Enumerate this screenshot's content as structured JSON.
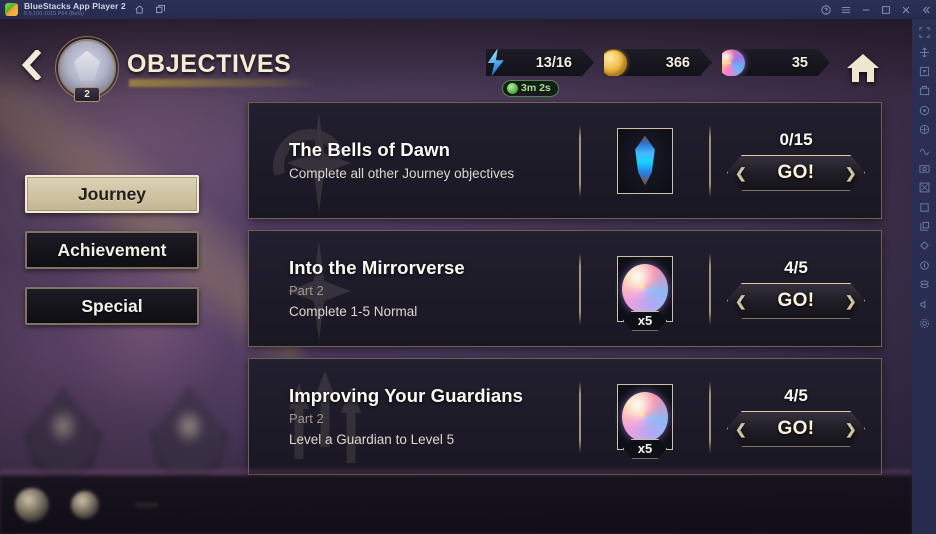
{
  "window": {
    "app_title": "BlueStacks App Player 2",
    "app_version": "5.5.100.1015 P64 (Beta)",
    "titlebar_icons": [
      "home-icon",
      "multi-instance-icon"
    ],
    "controls": [
      "help-icon",
      "menu-icon",
      "minimize-icon",
      "maximize-icon",
      "close-icon",
      "collapse-icon"
    ]
  },
  "rail": {
    "icons": [
      "fullscreen-icon",
      "keymapping-icon",
      "screen-rotate-icon",
      "install-apk-icon",
      "location-icon",
      "gamepad-icon",
      "shake-icon",
      "screenshot-icon",
      "screen-record-icon",
      "copy-to-clipboard-icon",
      "paste-icon",
      "macro-icon",
      "eco-mode-icon",
      "multi-instance-sync-icon",
      "volume-icon",
      "settings-icon"
    ]
  },
  "header": {
    "back_label": "back",
    "avatar_level": "2",
    "title": "OBJECTIVES",
    "home_label": "home",
    "currencies": [
      {
        "id": "energy",
        "icon": "energy-bolt-icon",
        "value": "13/16"
      },
      {
        "id": "gold",
        "icon": "gold-coin-icon",
        "value": "366"
      },
      {
        "id": "gem",
        "icon": "mirror-orb-icon",
        "value": "35"
      }
    ],
    "energy_timer": "3m 2s"
  },
  "tabs": [
    {
      "id": "journey",
      "label": "Journey",
      "active": true
    },
    {
      "id": "achievement",
      "label": "Achievement",
      "active": false
    },
    {
      "id": "special",
      "label": "Special",
      "active": false
    }
  ],
  "objectives": [
    {
      "id": "bells-of-dawn",
      "title": "The Bells of Dawn",
      "part": "",
      "description": "Complete all other Journey objectives",
      "reward_icon": "blue-crystal-icon",
      "reward_qty": "",
      "progress": "0/15",
      "action_label": "GO!",
      "watermark": "star-swirl"
    },
    {
      "id": "into-the-mirrorverse",
      "title": "Into the Mirrorverse",
      "part": "Part 2",
      "description": "Complete 1-5 Normal",
      "reward_icon": "mirror-orb-icon",
      "reward_qty": "x5",
      "progress": "4/5",
      "action_label": "GO!",
      "watermark": "four-point-star"
    },
    {
      "id": "improving-your-guardians",
      "title": "Improving Your Guardians",
      "part": "Part 2",
      "description": "Level a Guardian to Level 5",
      "reward_icon": "mirror-orb-icon",
      "reward_qty": "x5",
      "progress": "4/5",
      "action_label": "GO!",
      "watermark": "up-arrows"
    }
  ],
  "bottom_bar": {
    "chip": "",
    "messages": [
      "",
      "",
      ""
    ]
  },
  "colors": {
    "accent_gold": "#d9cdaa",
    "card_bg": "#1d1b28",
    "card_border": "#6e6352",
    "title_text": "#f6ecd4",
    "tab_active_bg": "#ddd2b6",
    "timer_green": "#9fe08a"
  }
}
